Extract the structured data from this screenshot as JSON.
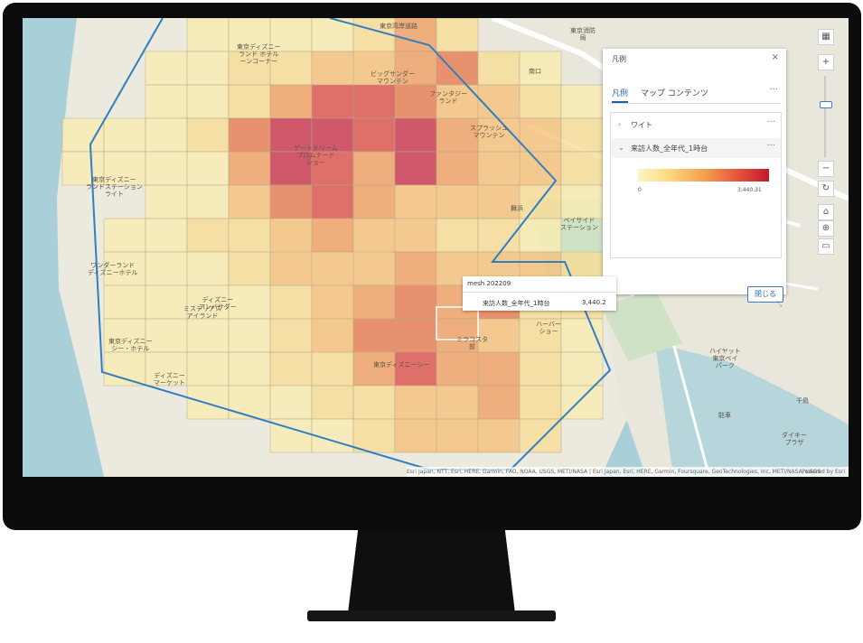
{
  "panel": {
    "title": "凡例",
    "close_glyph": "×",
    "tabs": [
      {
        "label": "凡例",
        "active": true
      },
      {
        "label": "マップ コンテンツ",
        "active": false
      }
    ],
    "more_glyph": "···",
    "layers": [
      {
        "label": "ワイト",
        "expanded": false
      },
      {
        "label": "来訪人数_全年代_1時台",
        "expanded": true
      }
    ],
    "legend": {
      "min_label": "0",
      "max_label": "3,440.31"
    },
    "close_button": "閉じる",
    "resize_glyph": "⤡"
  },
  "popup": {
    "title": "mesh 202209",
    "field_label": "来訪人数_全年代_1時台",
    "field_value": "3,440.2"
  },
  "toolbar": {
    "layers_glyph": "▦",
    "zoom_in": "+",
    "zoom_out": "−",
    "rotate_glyph": "↻",
    "home_glyph": "⌂",
    "locate_glyph": "⊕",
    "fullscreen_glyph": "▭"
  },
  "map_labels": [
    "東京ディズニー\nランド ホテル\nーンコーナー",
    "ビッグサンダー\nマウンテン",
    "ファンタジー\nランド",
    "スプラッシュ\nマウンテン",
    "ゲートドリーム\nプロムナード\nショー",
    "東京ディズニー\nランドステーション\nライト",
    "ベイサイド\nステーション",
    "ワンダーランド\nディズニーホテル",
    "ミステリアス\nアイランド",
    "東京ディズニーシー",
    "ミラコスタ\n前",
    "ハーバー\nショー",
    "東京ディズニー\nシー・ホテル",
    "ディズニー\nマーケット",
    "舞浜",
    "ハイヤット\n東京ベイ\nパーク",
    "東京湾岸道路",
    "東京消防\n局",
    "南口",
    "千鳥",
    "ダイキー\nプラザ",
    "駐車",
    "ディズニー\nアンバサダー"
  ],
  "attribution": {
    "text": "Esri Japan, NTT, Esri, HERE, Garmin, FAO, NOAA, USGS, METI/NASA | Esri Japan, Esri, HERE, Garmin, Foursquare, GeoTechnologies, Inc, METI/NASA, USGS",
    "powered_by": "Powered by Esri"
  },
  "grid_data": {
    "description": "",
    "rows": [
      [
        0,
        0,
        0,
        1,
        1,
        1,
        1,
        2,
        4,
        2,
        0,
        0,
        0
      ],
      [
        0,
        0,
        1,
        1,
        2,
        2,
        3,
        3,
        4,
        5,
        2,
        1,
        0
      ],
      [
        0,
        0,
        1,
        1,
        2,
        4,
        6,
        6,
        5,
        3,
        3,
        2,
        1
      ],
      [
        1,
        1,
        1,
        2,
        5,
        7,
        7,
        6,
        7,
        4,
        3,
        3,
        2
      ],
      [
        1,
        1,
        1,
        1,
        4,
        7,
        6,
        4,
        7,
        4,
        3,
        3,
        2
      ],
      [
        0,
        0,
        1,
        1,
        3,
        5,
        6,
        4,
        3,
        3,
        3,
        2,
        1
      ],
      [
        0,
        1,
        1,
        2,
        2,
        3,
        4,
        3,
        3,
        2,
        2,
        1,
        0
      ],
      [
        0,
        1,
        1,
        1,
        2,
        3,
        3,
        3,
        4,
        3,
        3,
        3,
        2
      ],
      [
        0,
        1,
        1,
        1,
        1,
        2,
        3,
        4,
        5,
        4,
        5,
        2,
        2
      ],
      [
        0,
        1,
        1,
        1,
        1,
        2,
        3,
        5,
        5,
        4,
        3,
        2,
        1
      ],
      [
        0,
        1,
        1,
        1,
        1,
        2,
        2,
        4,
        6,
        4,
        4,
        2,
        1
      ],
      [
        0,
        0,
        0,
        1,
        1,
        1,
        2,
        2,
        3,
        3,
        4,
        2,
        1
      ],
      [
        0,
        0,
        0,
        0,
        0,
        1,
        1,
        2,
        3,
        3,
        3,
        2,
        0
      ]
    ]
  }
}
